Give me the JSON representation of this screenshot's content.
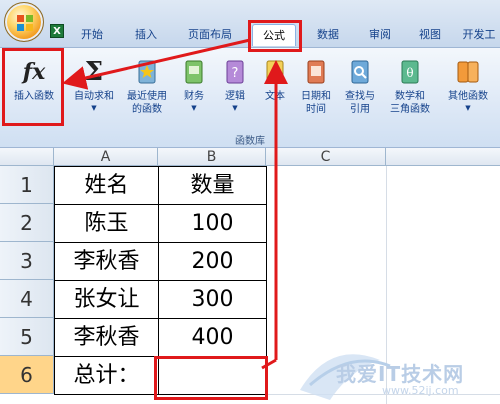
{
  "tabs": [
    {
      "label": "开始"
    },
    {
      "label": "插入"
    },
    {
      "label": "页面布局"
    },
    {
      "label": "公式",
      "active": true
    },
    {
      "label": "数据"
    },
    {
      "label": "审阅"
    },
    {
      "label": "视图"
    },
    {
      "label": "开发工"
    }
  ],
  "ribbon": {
    "group_label": "函数库",
    "buttons": [
      {
        "label": "插入函数",
        "icon": "fx-icon"
      },
      {
        "label": "自动求和",
        "icon": "sigma-icon"
      },
      {
        "label1": "最近使用",
        "label2": "的函数",
        "icon": "star-book-icon"
      },
      {
        "label": "财务",
        "icon": "finance-book-icon"
      },
      {
        "label": "逻辑",
        "icon": "logic-book-icon"
      },
      {
        "label": "文本",
        "icon": "text-book-icon"
      },
      {
        "label1": "日期和",
        "label2": "时间",
        "icon": "date-book-icon"
      },
      {
        "label1": "查找与",
        "label2": "引用",
        "icon": "lookup-book-icon"
      },
      {
        "label1": "数学和",
        "label2": "三角函数",
        "icon": "math-book-icon"
      },
      {
        "label": "其他函数",
        "icon": "other-book-icon"
      }
    ]
  },
  "columns": [
    "A",
    "B",
    "C"
  ],
  "rows": [
    {
      "num": "1",
      "name": "姓名",
      "qty": "数量"
    },
    {
      "num": "2",
      "name": "陈玉",
      "qty": "100"
    },
    {
      "num": "3",
      "name": "李秋香",
      "qty": "200"
    },
    {
      "num": "4",
      "name": "张女让",
      "qty": "300"
    },
    {
      "num": "5",
      "name": "李秋香",
      "qty": "400"
    },
    {
      "num": "6",
      "name": "总计：",
      "qty": ""
    }
  ],
  "watermark": {
    "text": "我爱IT技术网",
    "url": "www.52ij.com"
  },
  "colors": {
    "accent_red": "#e0191b",
    "ribbon_text": "#15428b"
  }
}
